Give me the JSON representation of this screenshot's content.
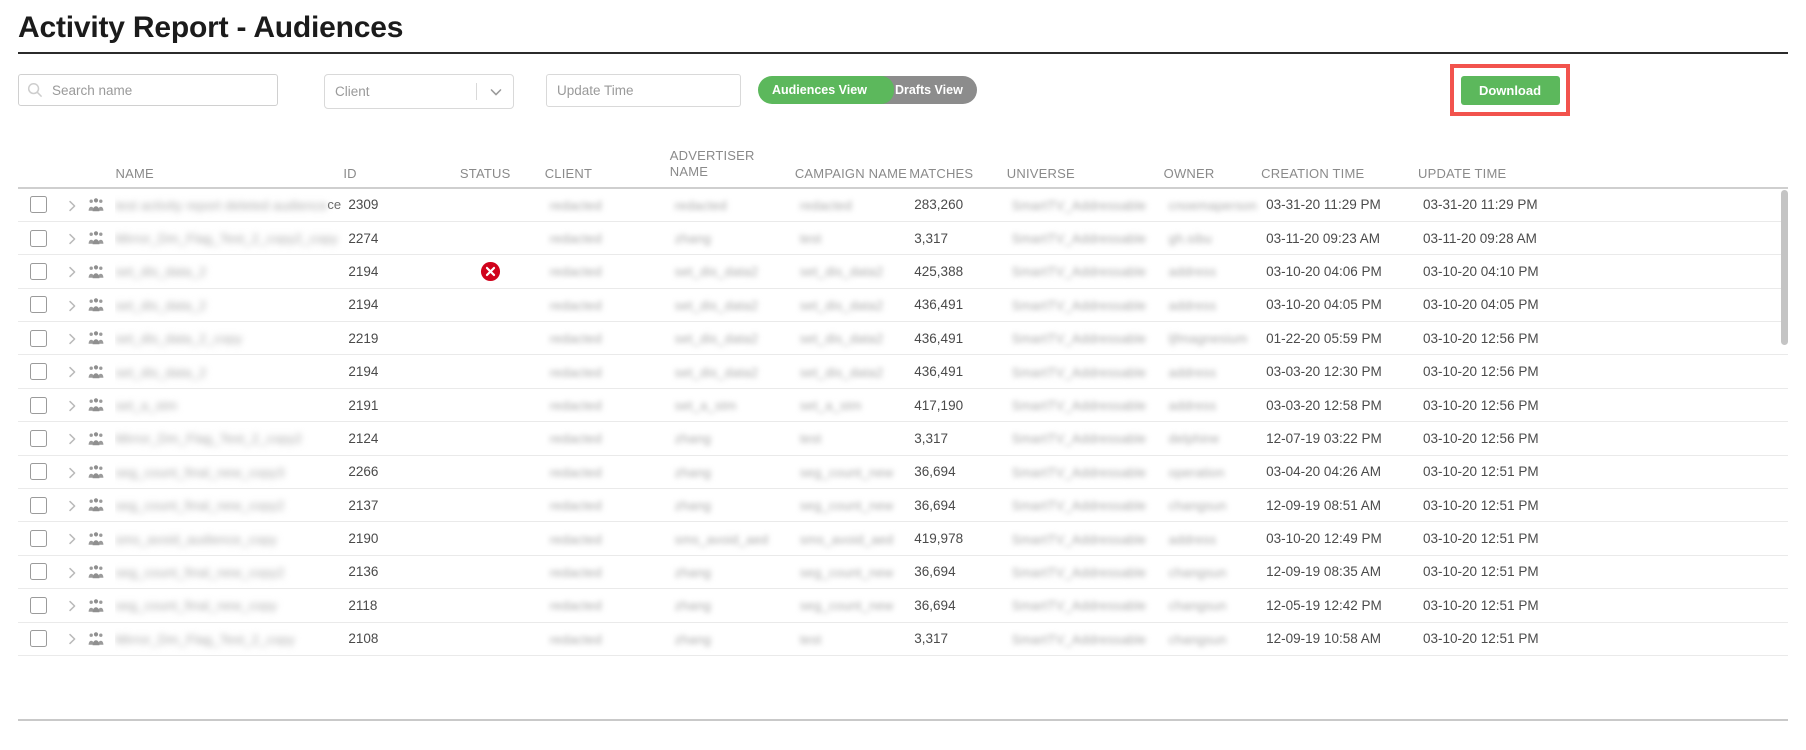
{
  "header": {
    "title": "Activity Report - Audiences"
  },
  "toolbar": {
    "search_placeholder": "Search name",
    "search_value": "",
    "search_icon": "search-icon",
    "client_placeholder": "Client",
    "client_value": "",
    "client_chevron_icon": "chevron-down-icon",
    "update_time_placeholder": "Update Time",
    "update_time_value": "",
    "view_toggle": {
      "active": "Audiences View",
      "inactive": "Drafts View"
    },
    "download_label": "Download",
    "colors": {
      "accent_green": "#5cb85c",
      "toggle_inactive_gray": "#8c8c8c",
      "highlight_red": "#f2534d",
      "status_error_red": "#d0021b"
    }
  },
  "table": {
    "columns": [
      "NAME",
      "ID",
      "STATUS",
      "CLIENT",
      "ADVERTISER NAME",
      "CAMPAIGN NAME",
      "MATCHES",
      "UNIVERSE",
      "OWNER",
      "CREATION TIME",
      "UPDATE TIME"
    ],
    "rows": [
      {
        "name": "test activity report deleted audience",
        "name_visible_tail": "ce",
        "id": "2309",
        "status": "",
        "client": "redacted",
        "advertiser_name": "redacted",
        "campaign_name": "redacted",
        "matches": "283,260",
        "universe": "SmartTV_Addressable",
        "owner": "cnoemaperson",
        "creation_time": "03-31-20 11:29 PM",
        "update_time": "03-31-20 11:29 PM"
      },
      {
        "name": "Mirror_Dm_Flag_Test_2_copy2_copy",
        "name_visible_tail": "",
        "id": "2274",
        "status": "",
        "client": "redacted",
        "advertiser_name": "zhang",
        "campaign_name": "test",
        "matches": "3,317",
        "universe": "SmartTV_Addressable",
        "owner": "gh.sibu",
        "creation_time": "03-11-20 09:23 AM",
        "update_time": "03-11-20 09:28 AM"
      },
      {
        "name": "set_dis_data_2",
        "name_visible_tail": "",
        "id": "2194",
        "status": "error",
        "client": "redacted",
        "advertiser_name": "set_dis_data2",
        "campaign_name": "set_dis_data2",
        "matches": "425,388",
        "universe": "SmartTV_Addressable",
        "owner": "address",
        "creation_time": "03-10-20 04:06 PM",
        "update_time": "03-10-20 04:10 PM"
      },
      {
        "name": "set_dis_data_2",
        "name_visible_tail": "",
        "id": "2194",
        "status": "",
        "client": "redacted",
        "advertiser_name": "set_dis_data2",
        "campaign_name": "set_dis_data2",
        "matches": "436,491",
        "universe": "SmartTV_Addressable",
        "owner": "address",
        "creation_time": "03-10-20 04:05 PM",
        "update_time": "03-10-20 04:05 PM"
      },
      {
        "name": "set_dis_data_2_copy",
        "name_visible_tail": "",
        "id": "2219",
        "status": "",
        "client": "redacted",
        "advertiser_name": "set_dis_data2",
        "campaign_name": "set_dis_data2",
        "matches": "436,491",
        "universe": "SmartTV_Addressable",
        "owner": "ljfmagnesium",
        "creation_time": "01-22-20 05:59 PM",
        "update_time": "03-10-20 12:56 PM"
      },
      {
        "name": "set_dis_data_2",
        "name_visible_tail": "",
        "id": "2194",
        "status": "",
        "client": "redacted",
        "advertiser_name": "set_dis_data2",
        "campaign_name": "set_dis_data2",
        "matches": "436,491",
        "universe": "SmartTV_Addressable",
        "owner": "address",
        "creation_time": "03-03-20 12:30 PM",
        "update_time": "03-10-20 12:56 PM"
      },
      {
        "name": "set_a_stm",
        "name_visible_tail": "",
        "id": "2191",
        "status": "",
        "client": "redacted",
        "advertiser_name": "set_a_stm",
        "campaign_name": "set_a_stm",
        "matches": "417,190",
        "universe": "SmartTV_Addressable",
        "owner": "address",
        "creation_time": "03-03-20 12:58 PM",
        "update_time": "03-10-20 12:56 PM"
      },
      {
        "name": "Mirror_Dm_Flag_Test_2_copy2",
        "name_visible_tail": "",
        "id": "2124",
        "status": "",
        "client": "redacted",
        "advertiser_name": "zhang",
        "campaign_name": "test",
        "matches": "3,317",
        "universe": "SmartTV_Addressable",
        "owner": "delphine",
        "creation_time": "12-07-19 03:22 PM",
        "update_time": "03-10-20 12:56 PM"
      },
      {
        "name": "seg_count_final_new_copy3",
        "name_visible_tail": "",
        "id": "2266",
        "status": "",
        "client": "redacted",
        "advertiser_name": "zhang",
        "campaign_name": "seg_count_new",
        "matches": "36,694",
        "universe": "SmartTV_Addressable",
        "owner": "operation",
        "creation_time": "03-04-20 04:26 AM",
        "update_time": "03-10-20 12:51 PM"
      },
      {
        "name": "seg_count_final_new_copy2",
        "name_visible_tail": "",
        "id": "2137",
        "status": "",
        "client": "redacted",
        "advertiser_name": "zhang",
        "campaign_name": "seg_count_new",
        "matches": "36,694",
        "universe": "SmartTV_Addressable",
        "owner": "changsun",
        "creation_time": "12-09-19 08:51 AM",
        "update_time": "03-10-20 12:51 PM"
      },
      {
        "name": "sms_avoid_audience_copy",
        "name_visible_tail": "",
        "id": "2190",
        "status": "",
        "client": "redacted",
        "advertiser_name": "sms_avoid_aed",
        "campaign_name": "sms_avoid_aed",
        "matches": "419,978",
        "universe": "SmartTV_Addressable",
        "owner": "address",
        "creation_time": "03-10-20 12:49 PM",
        "update_time": "03-10-20 12:51 PM"
      },
      {
        "name": "seg_count_final_new_copy2",
        "name_visible_tail": "",
        "id": "2136",
        "status": "",
        "client": "redacted",
        "advertiser_name": "zhang",
        "campaign_name": "seg_count_new",
        "matches": "36,694",
        "universe": "SmartTV_Addressable",
        "owner": "changsun",
        "creation_time": "12-09-19 08:35 AM",
        "update_time": "03-10-20 12:51 PM"
      },
      {
        "name": "seg_count_final_new_copy",
        "name_visible_tail": "",
        "id": "2118",
        "status": "",
        "client": "redacted",
        "advertiser_name": "zhang",
        "campaign_name": "seg_count_new",
        "matches": "36,694",
        "universe": "SmartTV_Addressable",
        "owner": "changsun",
        "creation_time": "12-05-19 12:42 PM",
        "update_time": "03-10-20 12:51 PM"
      },
      {
        "name": "Mirror_Dm_Flag_Test_2_copy",
        "name_visible_tail": "",
        "id": "2108",
        "status": "",
        "client": "redacted",
        "advertiser_name": "zhang",
        "campaign_name": "test",
        "matches": "3,317",
        "universe": "SmartTV_Addressable",
        "owner": "changsun",
        "creation_time": "12-09-19 10:58 AM",
        "update_time": "03-10-20 12:51 PM"
      }
    ]
  }
}
